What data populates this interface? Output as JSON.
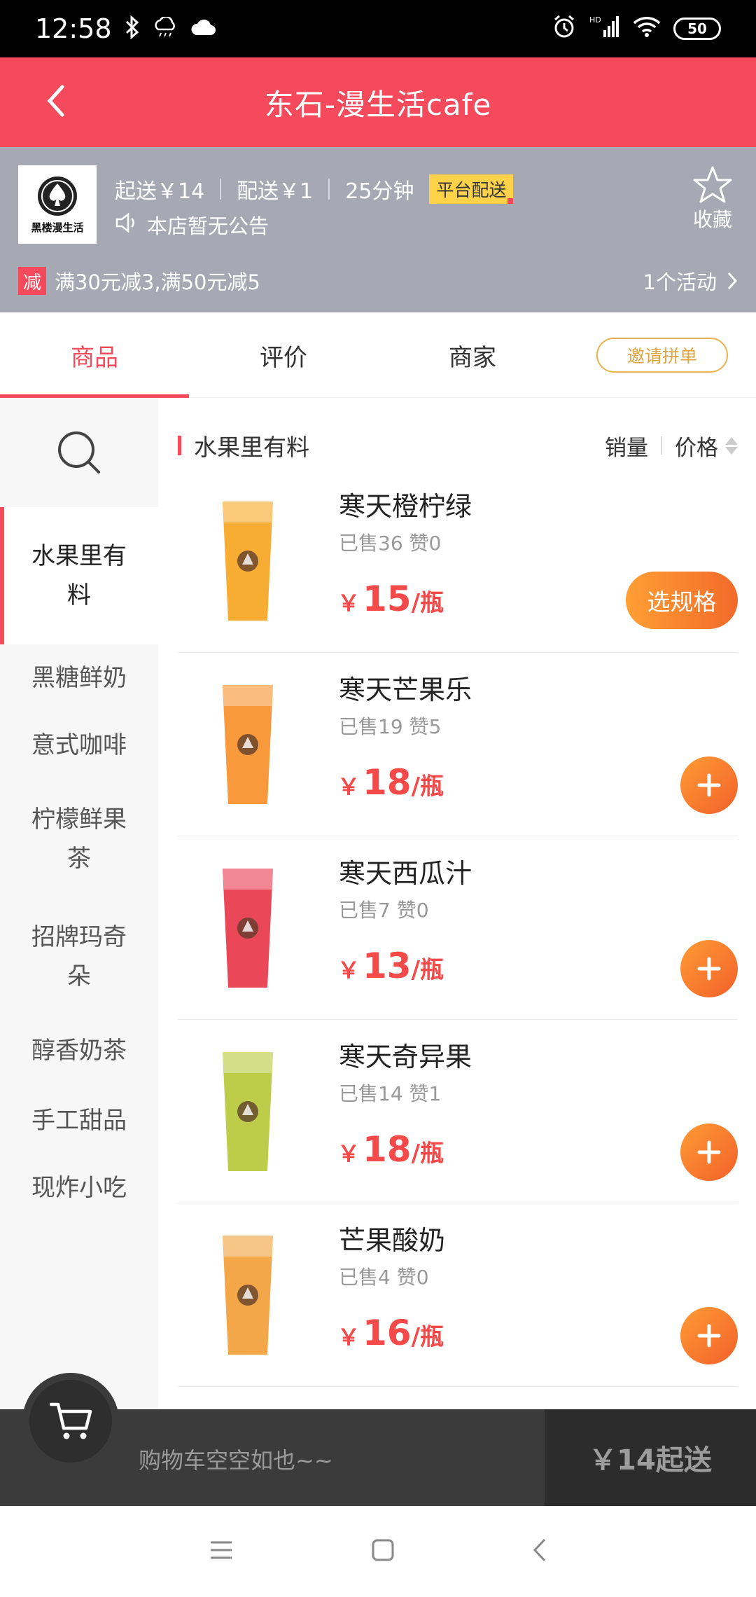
{
  "status_bar": {
    "time": "12:58",
    "battery": "50",
    "hd_label": "HD"
  },
  "header": {
    "title": "东石-漫生活cafe"
  },
  "shop": {
    "logo_text": "黑楼漫生活",
    "min_order": "起送￥14",
    "delivery_fee": "配送￥1",
    "delivery_time": "25分钟",
    "platform_badge": "平台配送",
    "notice": "本店暂无公告",
    "favorite_label": "收藏",
    "promo_tag": "减",
    "promo_text": "满30元减3,满50元减5",
    "activities_label": "1个活动"
  },
  "tabs": {
    "items": [
      "商品",
      "评价",
      "商家"
    ],
    "active": "商品",
    "invite_label": "邀请拼单"
  },
  "sidebar": {
    "items": [
      "水果里有料",
      "黑糖鲜奶",
      "意式咖啡",
      "柠檬鲜果茶",
      "招牌玛奇朵",
      "醇香奶茶",
      "手工甜品",
      "现炸小吃"
    ],
    "active": "水果里有料"
  },
  "category": {
    "name": "水果里有料",
    "sort_sales": "销量",
    "sort_price": "价格"
  },
  "products": [
    {
      "name": "寒天橙柠绿",
      "stats": "已售36 赞0",
      "currency": "￥",
      "price": "15",
      "unit": "/瓶",
      "action": "选规格",
      "drink_color": "#f6a623"
    },
    {
      "name": "寒天芒果乐",
      "stats": "已售19 赞5",
      "currency": "￥",
      "price": "18",
      "unit": "/瓶",
      "action": "+",
      "drink_color": "#f7902a"
    },
    {
      "name": "寒天西瓜汁",
      "stats": "已售7 赞0",
      "currency": "￥",
      "price": "13",
      "unit": "/瓶",
      "action": "+",
      "drink_color": "#e8384a"
    },
    {
      "name": "寒天奇异果",
      "stats": "已售14 赞1",
      "currency": "￥",
      "price": "18",
      "unit": "/瓶",
      "action": "+",
      "drink_color": "#b7c93a"
    },
    {
      "name": "芒果酸奶",
      "stats": "已售4 赞0",
      "currency": "￥",
      "price": "16",
      "unit": "/瓶",
      "action": "+",
      "drink_color": "#f2a03a"
    }
  ],
  "cart": {
    "empty_message": "购物车空空如也~~",
    "submit_label": "￥14起送"
  },
  "colors": {
    "brand_red": "#f54a5c",
    "price_red": "#f54a4a",
    "button_orange": "#f26a2a"
  }
}
